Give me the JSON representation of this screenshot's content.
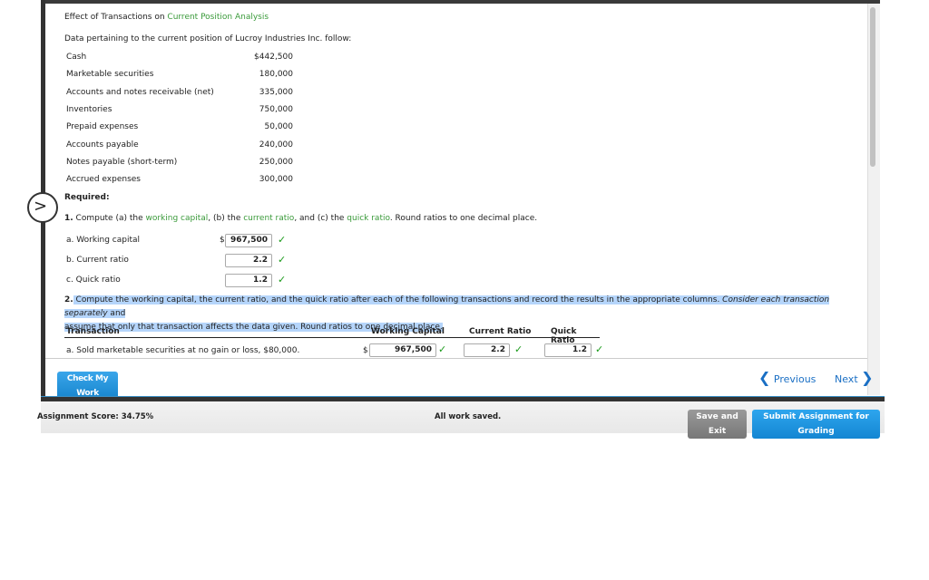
{
  "title": {
    "prefix": "Effect of Transactions on ",
    "link": "Current Position Analysis"
  },
  "intro": "Data pertaining to the current position of Lucroy Industries Inc. follow:",
  "items": [
    {
      "label": "Cash",
      "value": "$442,500"
    },
    {
      "label": "Marketable securities",
      "value": "180,000"
    },
    {
      "label": "Accounts and notes receivable (net)",
      "value": "335,000"
    },
    {
      "label": "Inventories",
      "value": "750,000"
    },
    {
      "label": "Prepaid expenses",
      "value": "50,000"
    },
    {
      "label": "Accounts payable",
      "value": "240,000"
    },
    {
      "label": "Notes payable (short-term)",
      "value": "250,000"
    },
    {
      "label": "Accrued expenses",
      "value": "300,000"
    }
  ],
  "required": "Required:",
  "q1": {
    "num": "1.",
    "t1": " Compute (a) the ",
    "l1": "working capital",
    "t2": ", (b) the ",
    "l2": "current ratio",
    "t3": ", and (c) the ",
    "l3": "quick ratio",
    "t4": ". Round ratios to one decimal place.",
    "answers": [
      {
        "label": "a.  Working capital",
        "prefix": "$",
        "value": "967,500"
      },
      {
        "label": "b.  Current ratio",
        "prefix": "",
        "value": "2.2"
      },
      {
        "label": "c.  Quick ratio",
        "prefix": "",
        "value": "1.2"
      }
    ]
  },
  "q2": {
    "num": "2.",
    "t1": " Compute the working capital, the current ratio, and the quick ratio after each of the following transactions and record the results in the appropriate columns. ",
    "italic": "Consider each transaction separately",
    "t2": " and",
    "line2": "assume that only that transaction affects the data given. Round ratios to one decimal place."
  },
  "table": {
    "headers": [
      "Transaction",
      "Working Capital",
      "Current Ratio",
      "Quick Ratio"
    ],
    "rows": [
      {
        "transaction": "a.  Sold marketable securities at no gain or loss, $80,000.",
        "wc_prefix": "$",
        "wc": "967,500",
        "cr": "2.2",
        "qr": "1.2"
      }
    ]
  },
  "buttons": {
    "check": "Check My Work",
    "previous": "Previous",
    "next": "Next",
    "save": "Save and Exit",
    "submit": "Submit Assignment for Grading"
  },
  "footer": {
    "score": "Assignment Score: 34.75%",
    "status": "All work saved."
  },
  "colors": {
    "link_green": "#3a9a3a",
    "check_green": "#1a9a1a",
    "button_blue": "#1b8fd8",
    "nav_blue": "#1a6fc4",
    "highlight": "#b5d5fb"
  }
}
